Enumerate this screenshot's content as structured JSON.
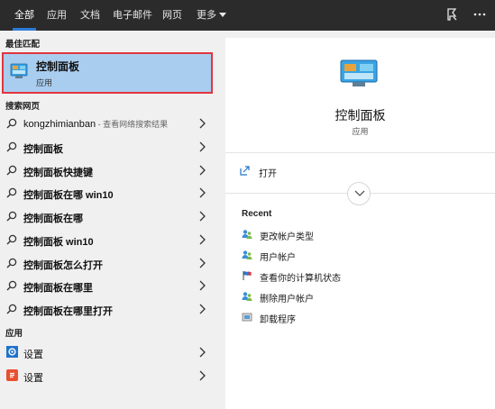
{
  "tabs": [
    {
      "label": "全部",
      "active": true
    },
    {
      "label": "应用"
    },
    {
      "label": "文档"
    },
    {
      "label": "电子邮件"
    },
    {
      "label": "网页"
    },
    {
      "label": "更多"
    }
  ],
  "top_icons": [
    "feedback-icon",
    "more-options-icon"
  ],
  "best_match": {
    "section_title": "最佳匹配",
    "title": "控制面板",
    "subtitle": "应用",
    "icon": "control-panel-icon"
  },
  "web_search": {
    "section_title": "搜索网页",
    "items": [
      {
        "label": "kongzhimianban",
        "hint": " - 查看网络搜索结果"
      },
      {
        "label": "控制面板"
      },
      {
        "label": "控制面板快捷键"
      },
      {
        "label": "控制面板在哪 win10"
      },
      {
        "label": "控制面板在哪"
      },
      {
        "label": "控制面板 win10"
      },
      {
        "label": "控制面板怎么打开"
      },
      {
        "label": "控制面板在哪里"
      },
      {
        "label": "控制面板在哪里打开"
      }
    ]
  },
  "apps": {
    "section_title": "应用",
    "items": [
      {
        "label": "设置",
        "icon": "settings-gear-icon"
      },
      {
        "label": "设置",
        "icon": "app-store-icon"
      }
    ]
  },
  "detail": {
    "title": "控制面板",
    "subtitle": "应用",
    "open_label": "打开",
    "recent_title": "Recent",
    "recent": [
      {
        "label": "更改帐户类型",
        "icon": "users-icon"
      },
      {
        "label": "用户帐户",
        "icon": "users-icon"
      },
      {
        "label": "查看你的计算机状态",
        "icon": "flag-icon"
      },
      {
        "label": "删除用户帐户",
        "icon": "users-icon"
      },
      {
        "label": "卸载程序",
        "icon": "programs-icon"
      }
    ]
  },
  "colors": {
    "topbar": "#2b2b2b",
    "accent": "#2d7ad6",
    "selected_bg": "#a9cdef",
    "highlight_border": "#e2353d"
  }
}
